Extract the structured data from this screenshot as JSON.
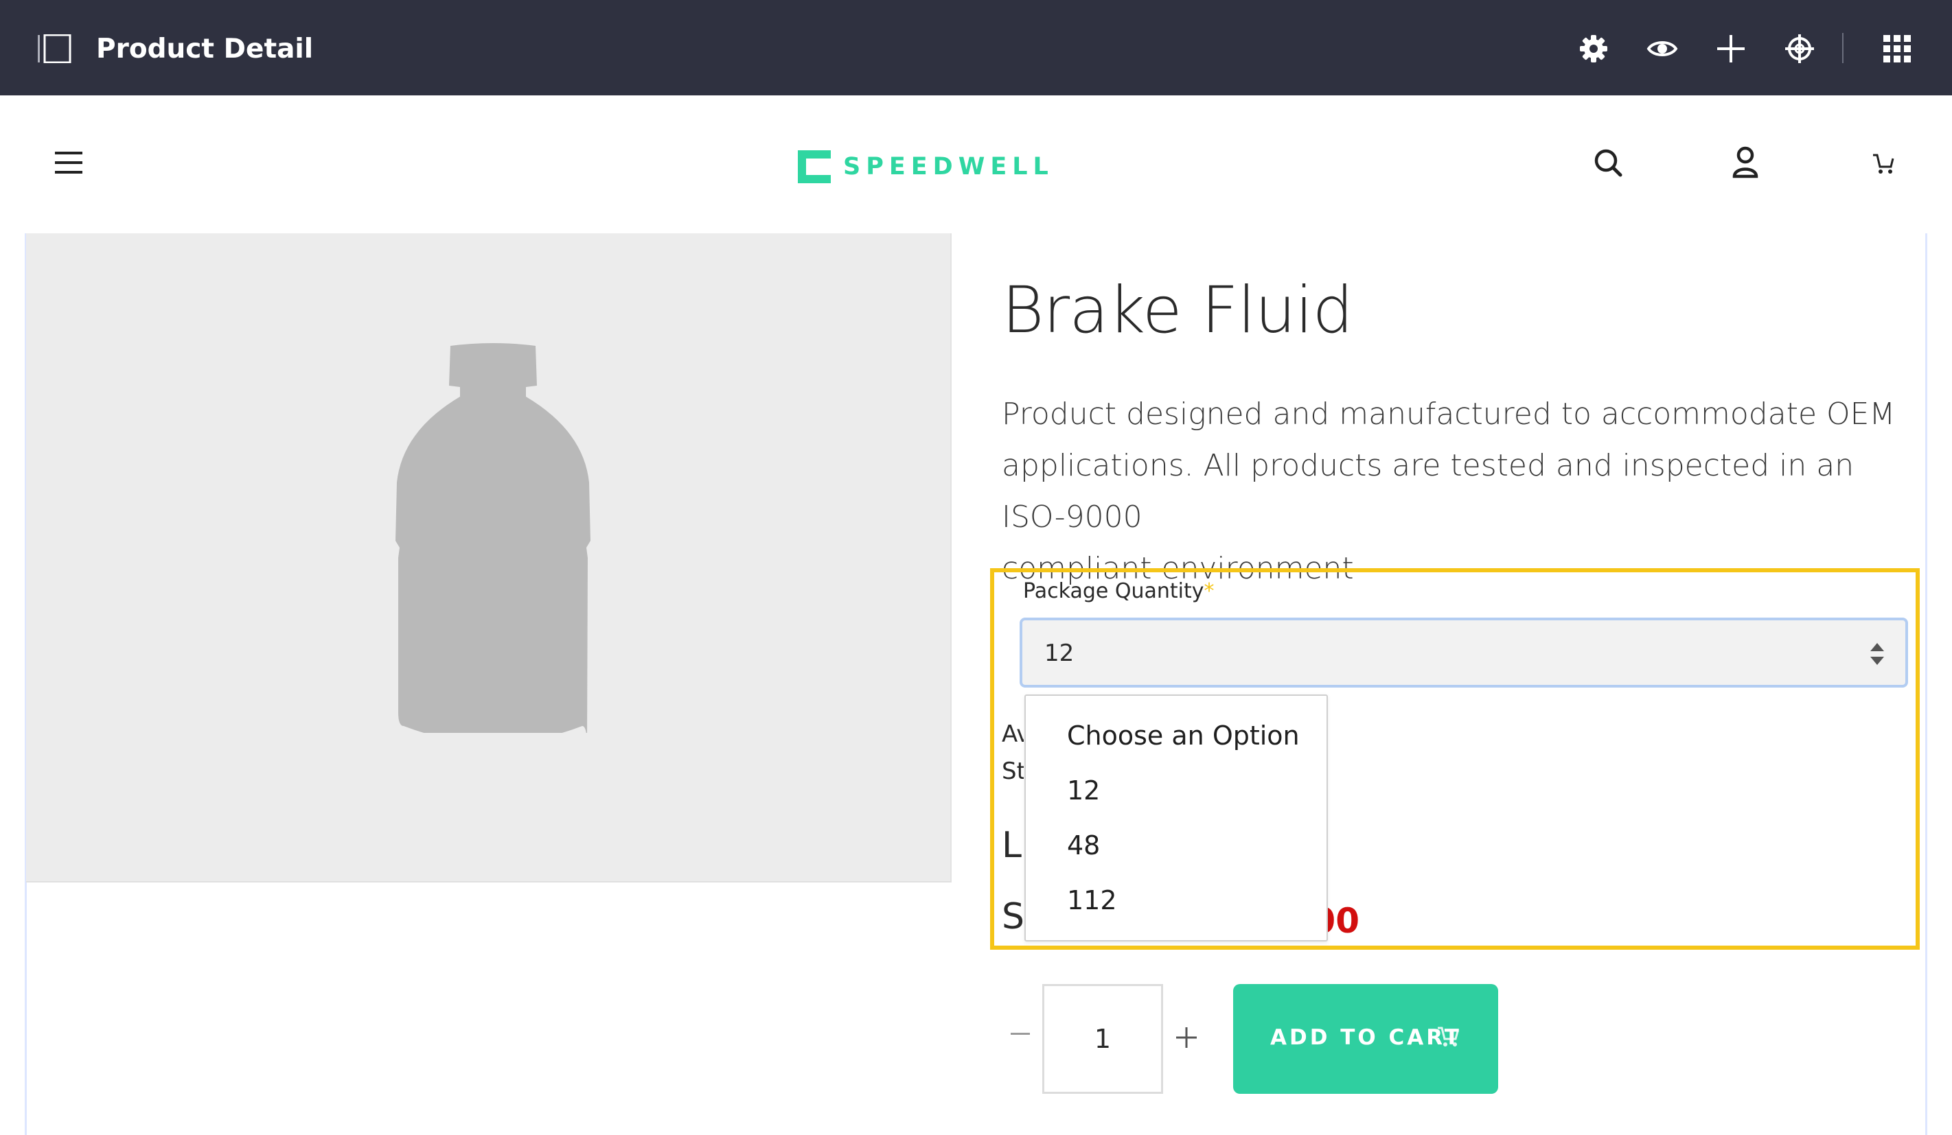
{
  "admin_bar": {
    "title": "Product Detail",
    "icons": [
      "sidebar-toggle-icon",
      "gear-icon",
      "eye-icon",
      "plus-icon",
      "target-icon",
      "apps-grid-icon"
    ]
  },
  "store_header": {
    "logo_text": "SPEEDWELL",
    "icons": [
      "menu-icon",
      "search-icon",
      "user-icon",
      "cart-icon"
    ],
    "accent_color": "#2fd6a1"
  },
  "product": {
    "title": "Brake Fluid",
    "description_lines": [
      "Product designed and manufactured to accommodate OEM",
      "applications. All products are tested and inspected in an ISO-9000",
      "compliant environment"
    ]
  },
  "options": {
    "label": "Package Quantity",
    "required_marker": "*",
    "selected_value": "12",
    "dropdown_items": [
      "Choose an Option",
      "12",
      "48",
      "112"
    ]
  },
  "obscured": {
    "availability_fragment": "Av",
    "stock_fragment": "St",
    "list_price_fragment": "LI",
    "sale_price_fragment": "SA",
    "sale_price_tail": "00",
    "sale_price_color": "#d20f0f"
  },
  "cart": {
    "quantity": "1",
    "add_to_cart_label": "ADD TO CART",
    "button_color": "#2fcfa0"
  },
  "highlight_color": "#f5c518"
}
